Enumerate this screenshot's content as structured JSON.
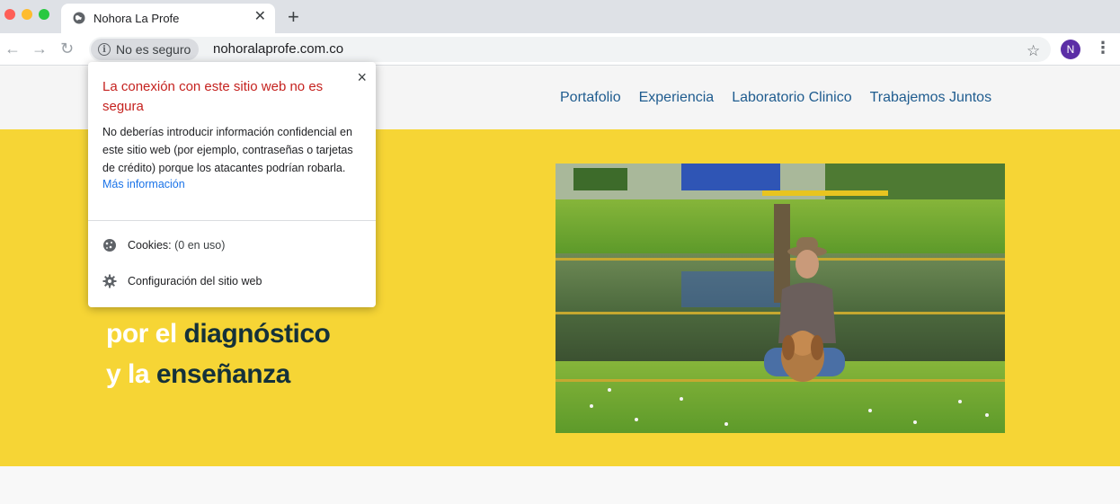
{
  "browser": {
    "tab_title": "Nohora La Profe",
    "new_tab_symbol": "+",
    "security_chip": "No es seguro",
    "url": "nohoralaprofe.com.co",
    "profile_initial": "N",
    "colors": {
      "close_light": "#fe5f57",
      "min_light": "#febc2e",
      "max_light": "#28c840"
    }
  },
  "site": {
    "nav": [
      "Portafolio",
      "Experiencia",
      "Laboratorio Clinico",
      "Trabajemos Juntos"
    ],
    "hero": {
      "line1_white": "por el ",
      "line1_dark": "diagnóstico",
      "line2_white": "y la ",
      "line2_dark": "enseñanza"
    },
    "colors": {
      "hero_bg": "#f6d535",
      "nav_link": "#1f5c8f",
      "hero_dark": "#14313a"
    }
  },
  "popup": {
    "title": "La conexión con este sitio web no es segura",
    "description": "No deberías introducir información confidencial en este sitio web (por ejemplo, contraseñas o tarjetas de crédito) porque los atacantes podrían robarla.",
    "link": "Más información",
    "cookies_label": "Cookies:",
    "cookies_value": " (0 en uso)",
    "settings_label": "Configuración del sitio web",
    "close_symbol": "×"
  }
}
